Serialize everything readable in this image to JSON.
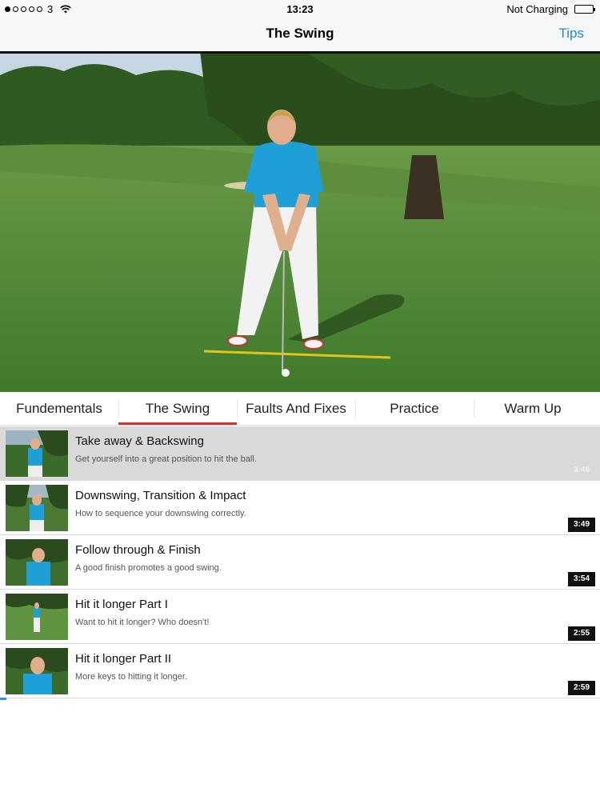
{
  "status": {
    "carrier": "3",
    "time": "13:23",
    "charging": "Not Charging",
    "signal_dots_filled": 1,
    "signal_dots_total": 5
  },
  "nav": {
    "title": "The Swing",
    "tips_label": "Tips"
  },
  "tabs": [
    {
      "label": "Fundementals",
      "active": false
    },
    {
      "label": "The Swing",
      "active": true
    },
    {
      "label": "Faults And Fixes",
      "active": false
    },
    {
      "label": "Practice",
      "active": false
    },
    {
      "label": "Warm Up",
      "active": false
    }
  ],
  "lessons": [
    {
      "title": "Take away & Backswing",
      "description": "Get yourself into a great position to hit the ball.",
      "duration": "3:46",
      "selected": true
    },
    {
      "title": "Downswing, Transition & Impact",
      "description": "How to sequence your downswing correctly.",
      "duration": "3:49",
      "selected": false
    },
    {
      "title": "Follow through & Finish",
      "description": "A good finish promotes a good swing.",
      "duration": "3:54",
      "selected": false
    },
    {
      "title": "Hit it longer Part I",
      "description": "Want to hit it longer?  Who doesn't!",
      "duration": "2:55",
      "selected": false
    },
    {
      "title": "Hit it longer Part II",
      "description": "More keys to hitting it longer.",
      "duration": "2:59",
      "selected": false
    }
  ],
  "colors": {
    "accent": "#1a8bd6",
    "tab_indicator": "#d9312a",
    "shirt": "#1e9fd8",
    "grass": "#4f8a34"
  }
}
